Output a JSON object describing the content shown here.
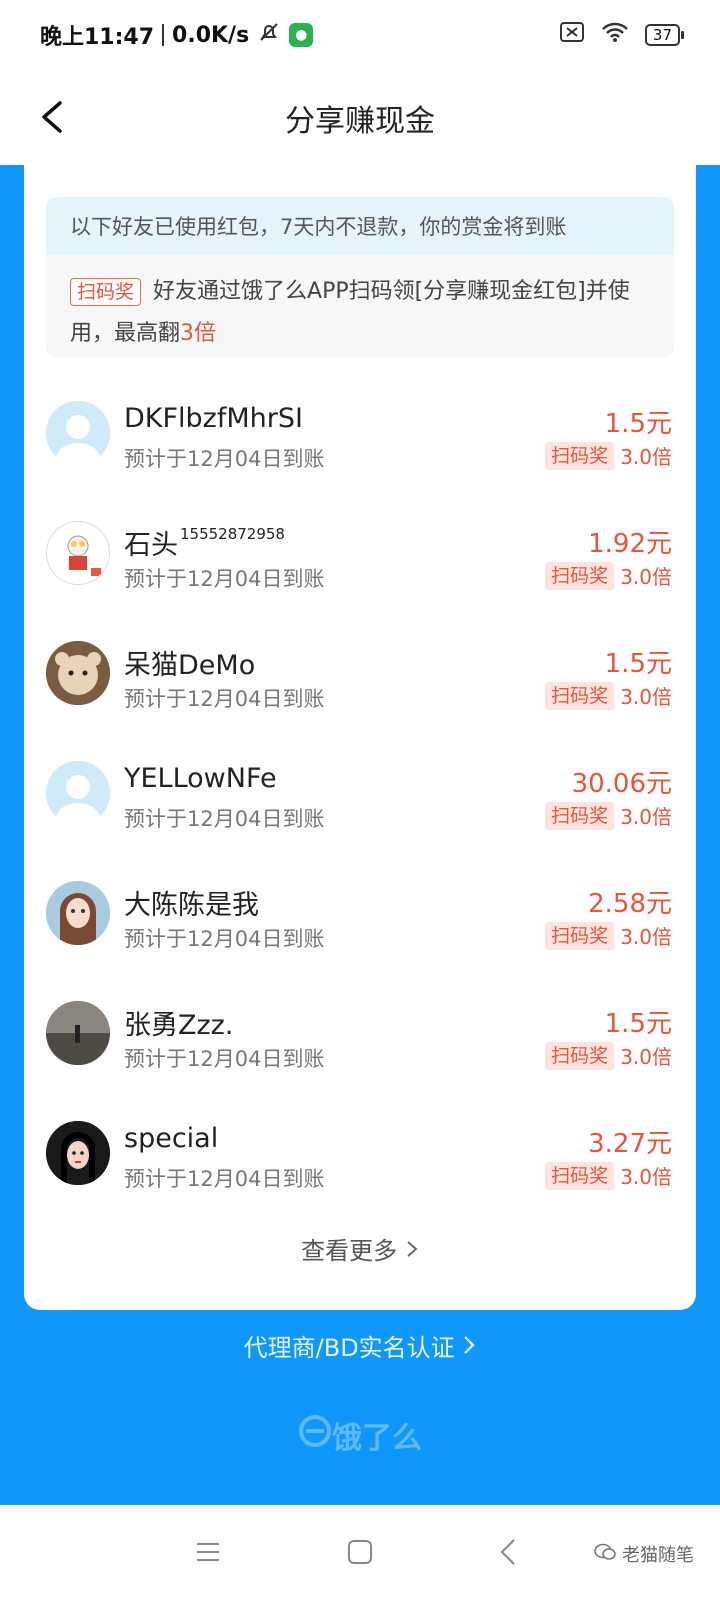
{
  "status_bar": {
    "time": "晚上11:47",
    "net_speed": "0.0K/s",
    "battery": "37"
  },
  "header": {
    "title": "分享赚现金"
  },
  "info": {
    "notice": "以下好友已使用红包，7天内不退款，你的赏金将到账",
    "tag": "扫码奖",
    "desc_before": "好友通过饿了么APP扫码领[分享赚现金红包]并使用，最高翻",
    "desc_highlight": "3倍"
  },
  "friends": [
    {
      "name": "DKFlbzfMhrSI",
      "name_sup": "",
      "eta": "预计于12月04日到账",
      "amount": "1.5元",
      "badge": "扫码奖",
      "multiplier": "3.0倍"
    },
    {
      "name": "石头",
      "name_sup": "15552872958",
      "eta": "预计于12月04日到账",
      "amount": "1.92元",
      "badge": "扫码奖",
      "multiplier": "3.0倍"
    },
    {
      "name": "呆猫DeMo",
      "name_sup": "",
      "eta": "预计于12月04日到账",
      "amount": "1.5元",
      "badge": "扫码奖",
      "multiplier": "3.0倍"
    },
    {
      "name": "YELLowNFe",
      "name_sup": "",
      "eta": "预计于12月04日到账",
      "amount": "30.06元",
      "badge": "扫码奖",
      "multiplier": "3.0倍"
    },
    {
      "name": "大陈陈是我",
      "name_sup": "",
      "eta": "预计于12月04日到账",
      "amount": "2.58元",
      "badge": "扫码奖",
      "multiplier": "3.0倍"
    },
    {
      "name": "张勇Zzz.",
      "name_sup": "",
      "eta": "预计于12月04日到账",
      "amount": "1.5元",
      "badge": "扫码奖",
      "multiplier": "3.0倍"
    },
    {
      "name": "special",
      "name_sup": "",
      "eta": "预计于12月04日到账",
      "amount": "3.27元",
      "badge": "扫码奖",
      "multiplier": "3.0倍"
    }
  ],
  "see_more": "查看更多",
  "agent_link": "代理商/BD实名认证",
  "brand": "饿了么",
  "watermark": "老猫随笔",
  "colors": {
    "brand_blue": "#0f97fb",
    "accent_red": "#e8553a",
    "notice_bg": "#e4f4fd"
  }
}
